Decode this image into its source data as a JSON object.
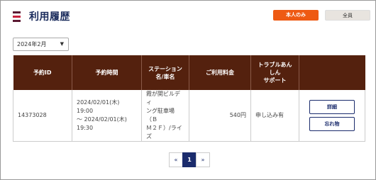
{
  "header": {
    "title": "利用履歴",
    "filter_self_label": "本人のみ",
    "filter_all_label": "全員"
  },
  "filters": {
    "month_value": "2024年2月"
  },
  "table": {
    "columns": [
      "予約ID",
      "予約時間",
      "ステーション名/車名",
      "ご利用料金",
      "トラブルあんしんサポート",
      ""
    ],
    "rows": [
      {
        "reservation_id": "14373028",
        "time_line1": "2024/02/01(木) 19:00",
        "time_line2": "～ 2024/02/01(木)",
        "time_line3": "19:30",
        "station_line1": "霞が関ビルディ",
        "station_line2": "ング駐車場（Ｂ",
        "station_line3": "Ｍ２Ｆ）/ライ",
        "station_line4": "ズ",
        "fee": "540円",
        "support": "申し込み有",
        "detail_label": "詳細",
        "lost_item_label": "忘れ物"
      }
    ]
  },
  "pagination": {
    "prev": "«",
    "current": "1",
    "next": "»"
  }
}
